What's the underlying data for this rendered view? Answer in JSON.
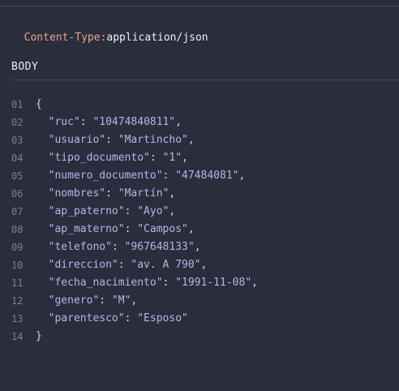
{
  "header": {
    "key": "Content-Type",
    "separator": ":",
    "value": "application/json"
  },
  "section": {
    "label": "BODY"
  },
  "code": {
    "open_brace": "{",
    "close_brace": "}",
    "line_numbers": [
      "01",
      "02",
      "03",
      "04",
      "05",
      "06",
      "07",
      "08",
      "09",
      "10",
      "11",
      "12",
      "13",
      "14"
    ],
    "fields": [
      {
        "key": "\"ruc\"",
        "value": "\"10474840811\"",
        "trail": ","
      },
      {
        "key": "\"usuario\"",
        "value": "\"Martincho\"",
        "trail": ","
      },
      {
        "key": "\"tipo_documento\"",
        "value": "\"1\"",
        "trail": ","
      },
      {
        "key": "\"numero_documento\"",
        "value": "\"47484081\"",
        "trail": ","
      },
      {
        "key": "\"nombres\"",
        "value": "\"Martín\"",
        "trail": ","
      },
      {
        "key": "\"ap_paterno\"",
        "value": "\"Ayo\"",
        "trail": ","
      },
      {
        "key": "\"ap_materno\"",
        "value": "\"Campos\"",
        "trail": ","
      },
      {
        "key": "\"telefono\"",
        "value": "\"967648133\"",
        "trail": ","
      },
      {
        "key": "\"direccion\"",
        "value": "\"av. A 790\"",
        "trail": ","
      },
      {
        "key": "\"fecha_nacimiento\"",
        "value": "\"1991-11-08\"",
        "trail": ","
      },
      {
        "key": "\"genero\"",
        "value": "\"M\"",
        "trail": ","
      },
      {
        "key": "\"parentesco\"",
        "value": "\"Esposo\"",
        "trail": ""
      }
    ],
    "colon": ": "
  },
  "colors": {
    "background": "#2b2d3c",
    "header_key": "#e3a58d",
    "code_text": "#b3b7e8",
    "line_number": "#7a7f96"
  }
}
